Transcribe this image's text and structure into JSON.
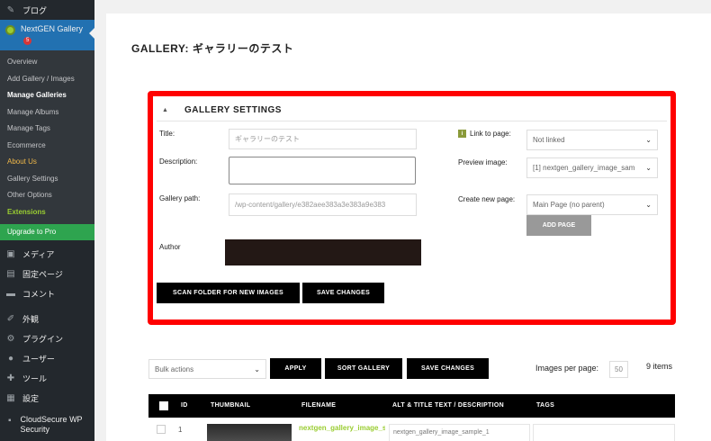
{
  "sidebar": {
    "top_items": [
      {
        "label": "ブログ",
        "icon": "pin-icon"
      }
    ],
    "nextgen": {
      "label": "NextGEN Gallery",
      "badge": "5"
    },
    "submenu": [
      {
        "label": "Overview",
        "state": "normal"
      },
      {
        "label": "Add Gallery / Images",
        "state": "normal"
      },
      {
        "label": "Manage Galleries",
        "state": "active"
      },
      {
        "label": "Manage Albums",
        "state": "normal"
      },
      {
        "label": "Manage Tags",
        "state": "normal"
      },
      {
        "label": "Ecommerce",
        "state": "normal"
      },
      {
        "label": "About Us",
        "state": "orange"
      },
      {
        "label": "Gallery Settings",
        "state": "normal"
      },
      {
        "label": "Other Options",
        "state": "normal"
      },
      {
        "label": "Extensions",
        "state": "green"
      }
    ],
    "upgrade": "Upgrade to Pro",
    "bottom_items": [
      {
        "label": "メディア",
        "icon": "media-icon"
      },
      {
        "label": "固定ページ",
        "icon": "pages-icon"
      },
      {
        "label": "コメント",
        "icon": "comments-icon"
      },
      {
        "label": "外観",
        "icon": "appearance-icon"
      },
      {
        "label": "プラグイン",
        "icon": "plugins-icon"
      },
      {
        "label": "ユーザー",
        "icon": "users-icon"
      },
      {
        "label": "ツール",
        "icon": "tools-icon"
      },
      {
        "label": "設定",
        "icon": "settings-icon"
      }
    ],
    "cloudsecure": "CloudSecure WP Security"
  },
  "page": {
    "title": "GALLERY: ギャラリーのテスト"
  },
  "settings": {
    "header": "GALLERY SETTINGS",
    "title_label": "Title:",
    "title_value": "ギャラリーのテスト",
    "description_label": "Description:",
    "description_value": "",
    "gallery_path_label": "Gallery path:",
    "gallery_path_value": "/wp-content/gallery/e382aee383a3e383a9e383",
    "author_label": "Author",
    "link_to_page_label": "Link to page:",
    "link_to_page_value": "Not linked",
    "preview_image_label": "Preview image:",
    "preview_image_value": "[1] nextgen_gallery_image_sam",
    "create_new_page_label": "Create new page:",
    "create_new_page_value": "Main Page (no parent)",
    "add_page_button": "ADD PAGE",
    "scan_folder_button": "SCAN FOLDER FOR NEW IMAGES",
    "save_changes_button": "SAVE CHANGES"
  },
  "toolbar": {
    "bulk_actions": "Bulk actions",
    "apply": "APPLY",
    "sort_gallery": "SORT GALLERY",
    "save_changes": "SAVE CHANGES",
    "images_per_page_label": "Images per page:",
    "images_per_page_value": "50",
    "items_count": "9 items"
  },
  "table": {
    "headers": [
      "ID",
      "THUMBNAIL",
      "FILENAME",
      "ALT & TITLE TEXT / DESCRIPTION",
      "TAGS"
    ],
    "rows": [
      {
        "id": "1",
        "filename": "nextgen_gallery_image_sa",
        "alt": "nextgen_gallery_image_sample_1"
      }
    ]
  },
  "icons": {
    "chevron": "chevron-down-icon",
    "info": "info-icon"
  }
}
